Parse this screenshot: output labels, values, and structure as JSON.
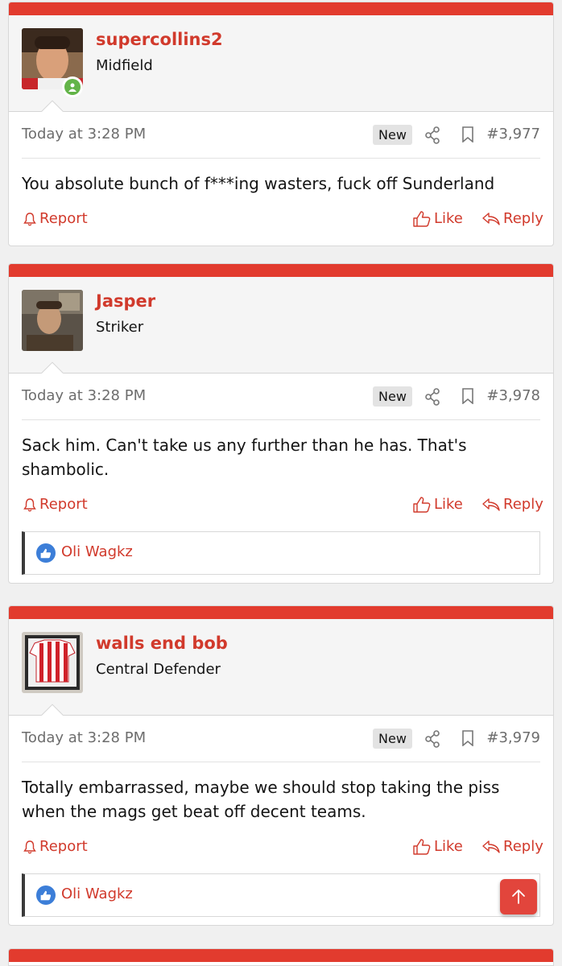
{
  "theme": {
    "accent": "#e23b2e",
    "link": "#d13a2c",
    "online": "#63b448",
    "reaction": "#3c7ed8"
  },
  "posts": [
    {
      "username": "supercollins2",
      "user_title": "Midfield",
      "online": true,
      "time": "Today at 3:28 PM",
      "badge": "New",
      "post_number": "#3,977",
      "body": "You absolute bunch of f***ing wasters, fuck off Sunderland",
      "report_label": "Report",
      "like_label": "Like",
      "reply_label": "Reply",
      "reactions": []
    },
    {
      "username": "Jasper",
      "user_title": "Striker",
      "online": false,
      "time": "Today at 3:28 PM",
      "badge": "New",
      "post_number": "#3,978",
      "body": "Sack him. Can't take us any further than he has. That's shambolic.",
      "report_label": "Report",
      "like_label": "Like",
      "reply_label": "Reply",
      "reactions": [
        "Oli Wagkz"
      ]
    },
    {
      "username": "walls end bob",
      "user_title": "Central Defender",
      "online": false,
      "time": "Today at 3:28 PM",
      "badge": "New",
      "post_number": "#3,979",
      "body": "Totally embarrassed, maybe we should stop taking the piss when the mags get beat off decent teams.",
      "report_label": "Report",
      "like_label": "Like",
      "reply_label": "Reply",
      "reactions": [
        "Oli Wagkz"
      ]
    }
  ],
  "icons": {
    "share": "share-icon",
    "bookmark": "bookmark-icon",
    "report": "bell-icon",
    "like": "thumbs-up-icon",
    "reply": "reply-arrow-icon",
    "scroll_top": "arrow-up-icon"
  }
}
